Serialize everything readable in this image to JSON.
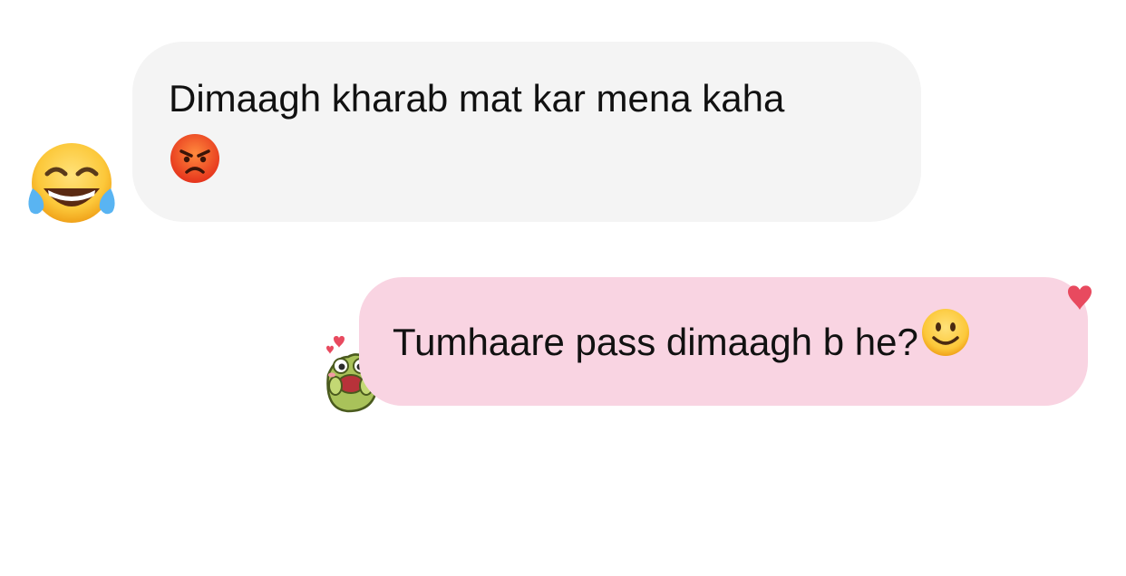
{
  "conversation": {
    "received": {
      "text": "Dimaagh kharab mat kar mena kaha",
      "trailing_emoji": "angry-face",
      "avatar_emoji": "face-with-tears-of-joy",
      "bubble_color": "#f4f4f4"
    },
    "sent": {
      "text": "Tumhaare pass dimaagh b he?",
      "trailing_emoji": "slightly-smiling-face",
      "reaction": "heart",
      "sticker": "frog-hearts",
      "bubble_color": "#f9d4e2",
      "reaction_color": "#e84a5f"
    }
  }
}
